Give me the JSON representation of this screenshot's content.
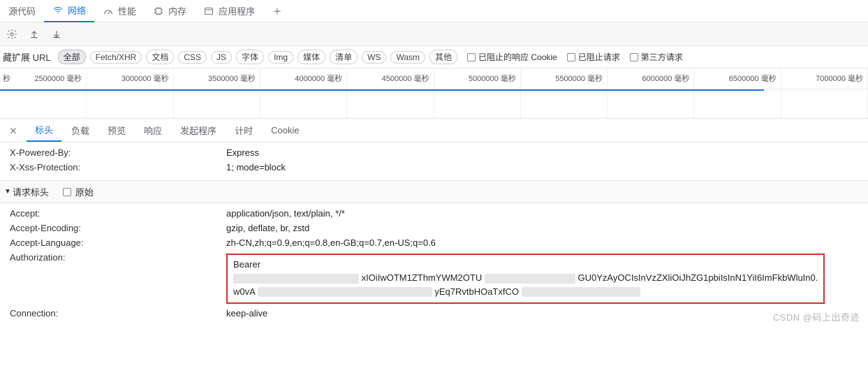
{
  "topTabs": {
    "source": "源代码",
    "network": "网络",
    "performance": "性能",
    "memory": "内存",
    "application": "应用程序"
  },
  "filter": {
    "urlLabel": "藏扩展 URL",
    "all": "全部",
    "fetchxhr": "Fetch/XHR",
    "doc": "文档",
    "css": "CSS",
    "js": "JS",
    "font": "字体",
    "img": "Img",
    "media": "媒体",
    "manifest": "清单",
    "ws": "WS",
    "wasm": "Wasm",
    "other": "其他",
    "blockedCookie": "已阻止的响应 Cookie",
    "blockedReq": "已阻止请求",
    "thirdParty": "第三方请求"
  },
  "timeline": {
    "unit": "毫秒",
    "firstUnit": "秒",
    "ticks": [
      "2500000",
      "3000000",
      "3500000",
      "4000000",
      "4500000",
      "5000000",
      "5500000",
      "6000000",
      "6500000",
      "7000000"
    ]
  },
  "detailTabs": {
    "headers": "标头",
    "payload": "负载",
    "preview": "预览",
    "response": "响应",
    "initiator": "发起程序",
    "timing": "计时",
    "cookie": "Cookie"
  },
  "responseHeaders": {
    "xPoweredBy": {
      "k": "X-Powered-By:",
      "v": "Express"
    },
    "xXss": {
      "k": "X-Xss-Protection:",
      "v": "1; mode=block"
    }
  },
  "requestSection": {
    "title": "请求标头",
    "rawLabel": "原始"
  },
  "requestHeaders": {
    "accept": {
      "k": "Accept:",
      "v": "application/json, text/plain, */*"
    },
    "acceptEncoding": {
      "k": "Accept-Encoding:",
      "v": "gzip, deflate, br, zstd"
    },
    "acceptLanguage": {
      "k": "Accept-Language:",
      "v": "zh-CN,zh;q=0.9,en;q=0.8,en-GB;q=0.7,en-US;q=0.6"
    },
    "authorization": {
      "k": "Authorization:",
      "v1": "Bearer",
      "frag1": "xIOiIwOTM1ZThmYWM2OTU",
      "frag2": "GU0YzAyOCIsInVzZXliOiJhZG1pbiIsInN1YiI6ImFkbWluIn0.",
      "frag3": "w0vA",
      "frag4": "yEq7RvtbHOaTxfCO"
    },
    "connection": {
      "k": "Connection:",
      "v": "keep-alive"
    }
  },
  "watermark": "CSDN @码上出奇迹"
}
